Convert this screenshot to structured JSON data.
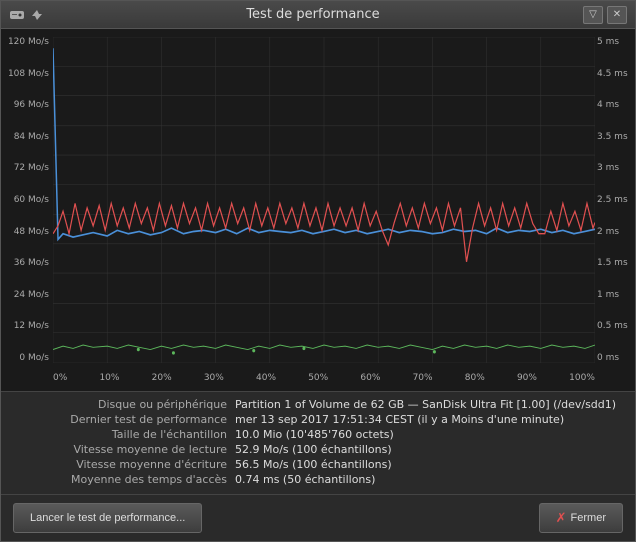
{
  "titlebar": {
    "title": "Test de performance",
    "minimize_label": "−",
    "maximize_label": "▽"
  },
  "chart": {
    "y_axis_left": [
      "0 Mo/s",
      "12 Mo/s",
      "24 Mo/s",
      "36 Mo/s",
      "48 Mo/s",
      "60 Mo/s",
      "72 Mo/s",
      "84 Mo/s",
      "96 Mo/s",
      "108 Mo/s",
      "120 Mo/s"
    ],
    "y_axis_right": [
      "0 ms",
      "0.5 ms",
      "1 ms",
      "1.5 ms",
      "2 ms",
      "2.5 ms",
      "3 ms",
      "3.5 ms",
      "4 ms",
      "4.5 ms",
      "5 ms"
    ],
    "x_axis": [
      "0%",
      "10%",
      "20%",
      "30%",
      "40%",
      "50%",
      "60%",
      "70%",
      "80%",
      "90%",
      "100%"
    ]
  },
  "info": {
    "device_label": "Disque ou périphérique",
    "device_value": "Partition 1 of Volume de 62 GB — SanDisk Ultra Fit [1.00] (/dev/sdd1)",
    "last_test_label": "Dernier test de performance",
    "last_test_value": "mer 13 sep 2017 17:51:34 CEST (il y a Moins d'une minute)",
    "sample_size_label": "Taille de l'échantillon",
    "sample_size_value": "10.0 Mio (10'485'760 octets)",
    "read_speed_label": "Vitesse moyenne de lecture",
    "read_speed_value": "52.9 Mo/s (100 échantillons)",
    "write_speed_label": "Vitesse moyenne d'écriture",
    "write_speed_value": "56.5 Mo/s (100 échantillons)",
    "access_time_label": "Moyenne des temps d'accès",
    "access_time_value": "0.74 ms (50 échantillons)"
  },
  "footer": {
    "launch_label": "Lancer le test de performance...",
    "close_label": "Fermer"
  }
}
